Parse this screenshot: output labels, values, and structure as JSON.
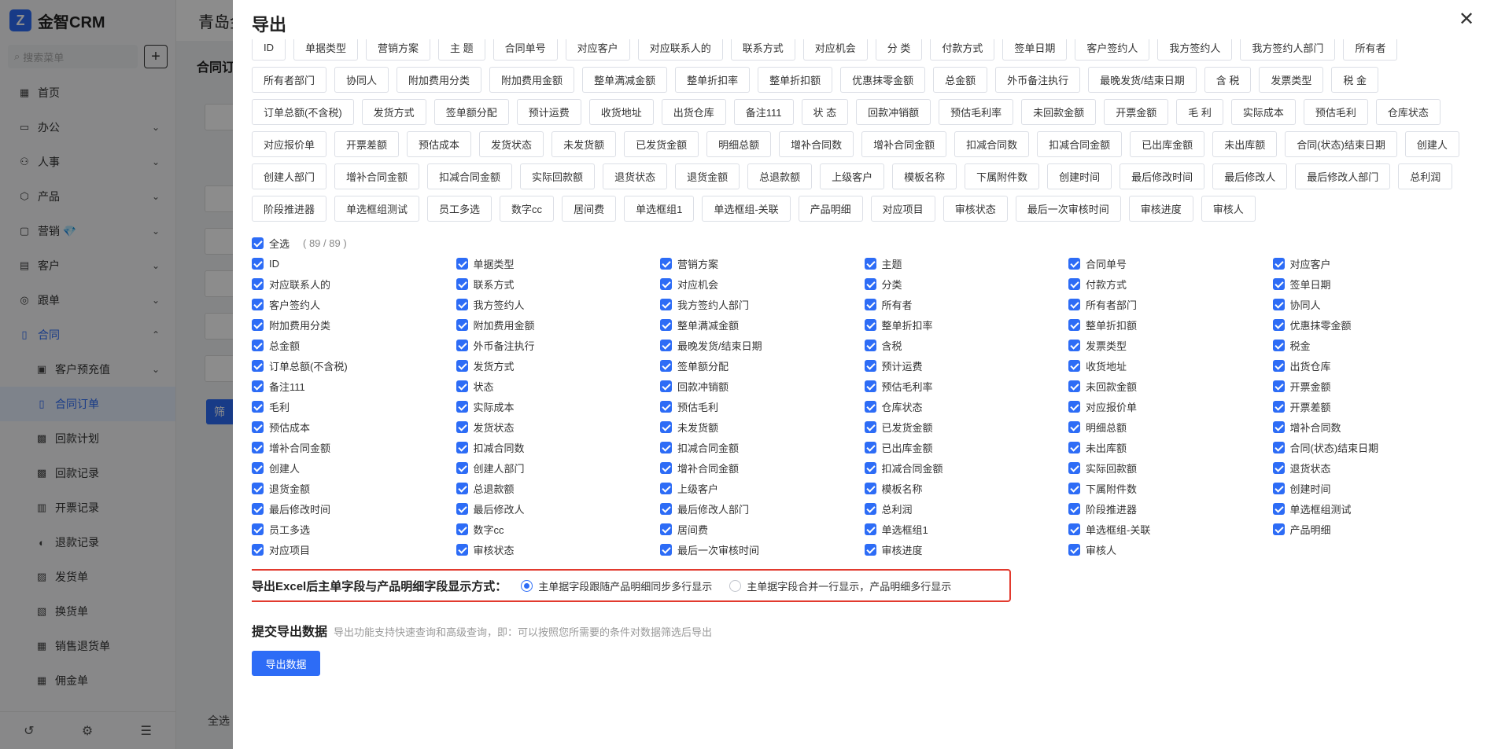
{
  "app": {
    "brand": "金智CRM",
    "search_placeholder": "搜索菜单",
    "header_title": "青岛金",
    "sub_title": "合同订",
    "bg_button": "筛",
    "bg_bottom_text": "全选",
    "menu": [
      {
        "label": "首页",
        "icon": "▦",
        "chev": ""
      },
      {
        "label": "办公",
        "icon": "▭",
        "chev": "⌄"
      },
      {
        "label": "人事",
        "icon": "⚇",
        "chev": "⌄"
      },
      {
        "label": "产品",
        "icon": "⬡",
        "chev": "⌄"
      },
      {
        "label": "营销 💎",
        "icon": "▢",
        "chev": "⌄"
      },
      {
        "label": "客户",
        "icon": "▤",
        "chev": "⌄"
      },
      {
        "label": "跟单",
        "icon": "◎",
        "chev": "⌄"
      },
      {
        "label": "合同",
        "icon": "▯",
        "chev": "⌃"
      },
      {
        "label": "客户预充值",
        "icon": "▣",
        "chev": "⌄"
      },
      {
        "label": "合同订单",
        "icon": "▯",
        "chev": ""
      },
      {
        "label": "回款计划",
        "icon": "▩",
        "chev": ""
      },
      {
        "label": "回款记录",
        "icon": "▩",
        "chev": ""
      },
      {
        "label": "开票记录",
        "icon": "▥",
        "chev": ""
      },
      {
        "label": "退款记录",
        "icon": "◐",
        "chev": ""
      },
      {
        "label": "发货单",
        "icon": "▨",
        "chev": ""
      },
      {
        "label": "换货单",
        "icon": "▧",
        "chev": ""
      },
      {
        "label": "销售退货单",
        "icon": "▦",
        "chev": ""
      },
      {
        "label": "佣金单",
        "icon": "▦",
        "chev": ""
      }
    ]
  },
  "drawer": {
    "title": "导出",
    "close": "✕",
    "field_tags": [
      "ID",
      "单据类型",
      "营销方案",
      "主 题",
      "合同单号",
      "对应客户",
      "对应联系人的",
      "联系方式",
      "对应机会",
      "分 类",
      "付款方式",
      "签单日期",
      "客户签约人",
      "我方签约人",
      "我方签约人部门",
      "所有者",
      "所有者部门",
      "协同人",
      "附加费用分类",
      "附加费用金额",
      "整单满减金额",
      "整单折扣率",
      "整单折扣额",
      "优惠抹零金额",
      "总金额",
      "外币备注执行",
      "最晚发货/结束日期",
      "含 税",
      "发票类型",
      "税 金",
      "订单总额(不含税)",
      "发货方式",
      "签单额分配",
      "预计运费",
      "收货地址",
      "出货仓库",
      "备注111",
      "状 态",
      "回款冲销额",
      "预估毛利率",
      "未回款金额",
      "开票金额",
      "毛 利",
      "实际成本",
      "预估毛利",
      "仓库状态",
      "对应报价单",
      "开票差额",
      "预估成本",
      "发货状态",
      "未发货额",
      "已发货金额",
      "明细总额",
      "增补合同数",
      "增补合同金额",
      "扣减合同数",
      "扣减合同金额",
      "已出库金额",
      "未出库额",
      "合同(状态)结束日期",
      "创建人",
      "创建人部门",
      "增补合同金额",
      "扣减合同金额",
      "实际回款额",
      "退货状态",
      "退货金额",
      "总退款额",
      "上级客户",
      "模板名称",
      "下属附件数",
      "创建时间",
      "最后修改时间",
      "最后修改人",
      "最后修改人部门",
      "总利润",
      "阶段推进器",
      "单选框组测试",
      "员工多选",
      "数字cc",
      "居间费",
      "单选框组1",
      "单选框组-关联",
      "产品明细",
      "对应项目",
      "审核状态",
      "最后一次审核时间",
      "审核进度",
      "审核人"
    ],
    "select_all_label": "全选",
    "select_count": "( 89 / 89 )",
    "checkbox_fields": [
      "ID",
      "单据类型",
      "营销方案",
      "主题",
      "合同单号",
      "对应客户",
      "对应联系人的",
      "联系方式",
      "对应机会",
      "分类",
      "付款方式",
      "签单日期",
      "客户签约人",
      "我方签约人",
      "我方签约人部门",
      "所有者",
      "所有者部门",
      "协同人",
      "附加费用分类",
      "附加费用金额",
      "整单满减金额",
      "整单折扣率",
      "整单折扣额",
      "优惠抹零金额",
      "总金额",
      "外币备注执行",
      "最晚发货/结束日期",
      "含税",
      "发票类型",
      "税金",
      "订单总额(不含税)",
      "发货方式",
      "签单额分配",
      "预计运费",
      "收货地址",
      "出货仓库",
      "备注111",
      "状态",
      "回款冲销额",
      "预估毛利率",
      "未回款金额",
      "开票金额",
      "毛利",
      "实际成本",
      "预估毛利",
      "仓库状态",
      "对应报价单",
      "开票差额",
      "预估成本",
      "发货状态",
      "未发货额",
      "已发货金额",
      "明细总额",
      "增补合同数",
      "增补合同金额",
      "扣减合同数",
      "扣减合同金额",
      "已出库金额",
      "未出库额",
      "合同(状态)结束日期",
      "创建人",
      "创建人部门",
      "增补合同金额",
      "扣减合同金额",
      "实际回款额",
      "退货状态",
      "退货金额",
      "总退款额",
      "上级客户",
      "模板名称",
      "下属附件数",
      "创建时间",
      "最后修改时间",
      "最后修改人",
      "最后修改人部门",
      "总利润",
      "阶段推进器",
      "单选框组测试",
      "员工多选",
      "数字cc",
      "居间费",
      "单选框组1",
      "单选框组-关联",
      "产品明细",
      "对应项目",
      "审核状态",
      "最后一次审核时间",
      "审核进度",
      "审核人"
    ],
    "display_mode": {
      "label": "导出Excel后主单字段与产品明细字段显示方式：",
      "option_1": "主单据字段跟随产品明细同步多行显示",
      "option_2": "主单据字段合并一行显示，产品明细多行显示",
      "selected": 1
    },
    "submit_title": "提交导出数据",
    "submit_hint": "导出功能支持快速查询和高级查询，即：可以按照您所需要的条件对数据筛选后导出",
    "export_button": "导出数据"
  },
  "colors": {
    "primary": "#2d6cf6",
    "highlight_border": "#e23a2e"
  }
}
